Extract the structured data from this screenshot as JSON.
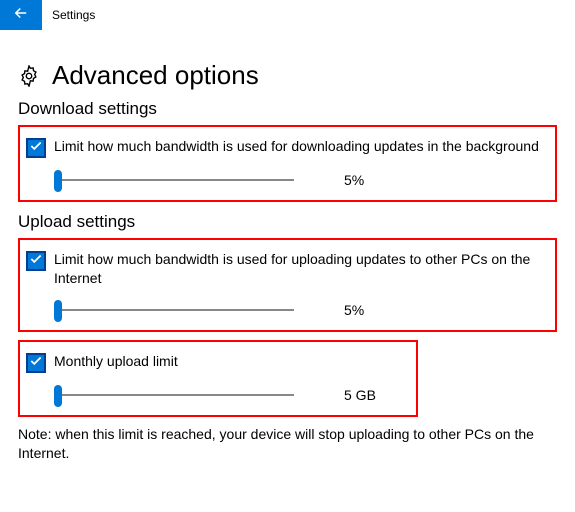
{
  "titlebar": {
    "title": "Settings"
  },
  "page": {
    "title": "Advanced options"
  },
  "download": {
    "section_title": "Download settings",
    "limit_label": "Limit how much bandwidth is used for downloading updates in the background",
    "slider_value": "5%"
  },
  "upload": {
    "section_title": "Upload settings",
    "limit_label": "Limit how much bandwidth is used for uploading updates to other PCs on the Internet",
    "slider_value": "5%",
    "monthly_label": "Monthly upload limit",
    "monthly_value": "5 GB"
  },
  "note": "Note: when this limit is reached, your device will stop uploading to other PCs on the Internet.",
  "icons": {
    "back": "back-arrow",
    "gear": "settings-gear",
    "check": "checkmark"
  }
}
